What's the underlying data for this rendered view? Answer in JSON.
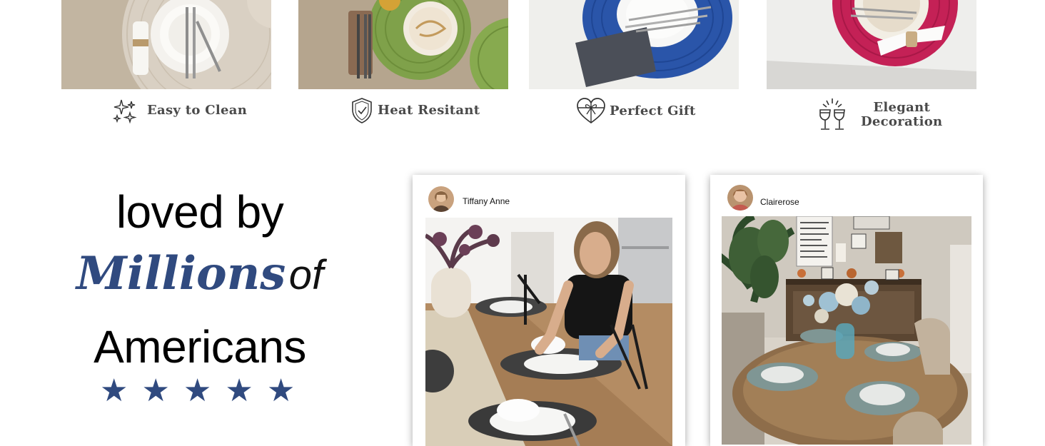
{
  "features": [
    {
      "label": "Easy to Clean",
      "icon": "sparkle-icon"
    },
    {
      "label": "Heat Resitant",
      "icon": "shield-check-icon"
    },
    {
      "label": "Perfect Gift",
      "icon": "gift-heart-icon"
    },
    {
      "label_line1": "Elegant",
      "label_line2": "Decoration",
      "icon": "wine-glasses-icon"
    }
  ],
  "heading": {
    "line1": "loved by",
    "emphasis": "Millions",
    "connector": "of",
    "line3": "Americans"
  },
  "rating": {
    "stars": 5,
    "star_glyph": "★"
  },
  "posts": [
    {
      "username": "Tiffany Anne"
    },
    {
      "username": "Clairerose"
    }
  ],
  "colors": {
    "accent_navy": "#304a7f",
    "caption_text": "#4a4a4a"
  }
}
